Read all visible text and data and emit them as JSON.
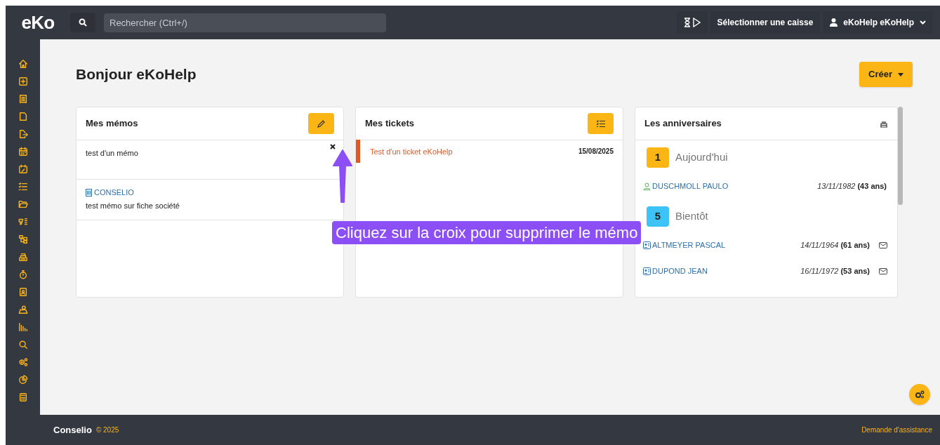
{
  "header": {
    "logo": "eKo",
    "search_placeholder": "Rechercher (Ctrl+/)",
    "register_button": "Sélectionner une caisse",
    "user": "eKoHelp eKoHelp"
  },
  "greeting": "Bonjour eKoHelp",
  "create_button": "Créer",
  "memos": {
    "title": "Mes mémos",
    "items": [
      {
        "kind": "note",
        "text": "test d'un mémo"
      },
      {
        "kind": "company_note",
        "company": "CONSELIO",
        "text": "test mémo sur fiche société"
      }
    ]
  },
  "tickets": {
    "title": "Mes tickets",
    "items": [
      {
        "title": "Test d'un ticket eKoHelp",
        "date": "15/08/2025",
        "color": "#e8541e"
      }
    ]
  },
  "birthdays": {
    "title": "Les anniversaires",
    "groups": [
      {
        "count": "1",
        "label": "Aujourd'hui",
        "color": "#fbb515",
        "people": [
          {
            "kind": "person",
            "name": "DUSCHMOLL PAULO",
            "date": "13/11/1982",
            "age": "(43 ans)",
            "email": false
          }
        ]
      },
      {
        "count": "5",
        "label": "Bientôt",
        "color": "#3dc3f5",
        "people": [
          {
            "kind": "contact",
            "name": "ALTMEYER PASCAL",
            "date": "14/11/1964",
            "age": "(61 ans)",
            "email": true
          },
          {
            "kind": "contact",
            "name": "DUPOND JEAN",
            "date": "16/11/1972",
            "age": "(53 ans)",
            "email": true
          }
        ]
      }
    ]
  },
  "tutorial": {
    "text": "Cliquez sur la croix pour supprimer le mémo"
  },
  "footer": {
    "brand": "Conselio",
    "copyright": "© 2025",
    "link": "Demande d'assistance"
  }
}
